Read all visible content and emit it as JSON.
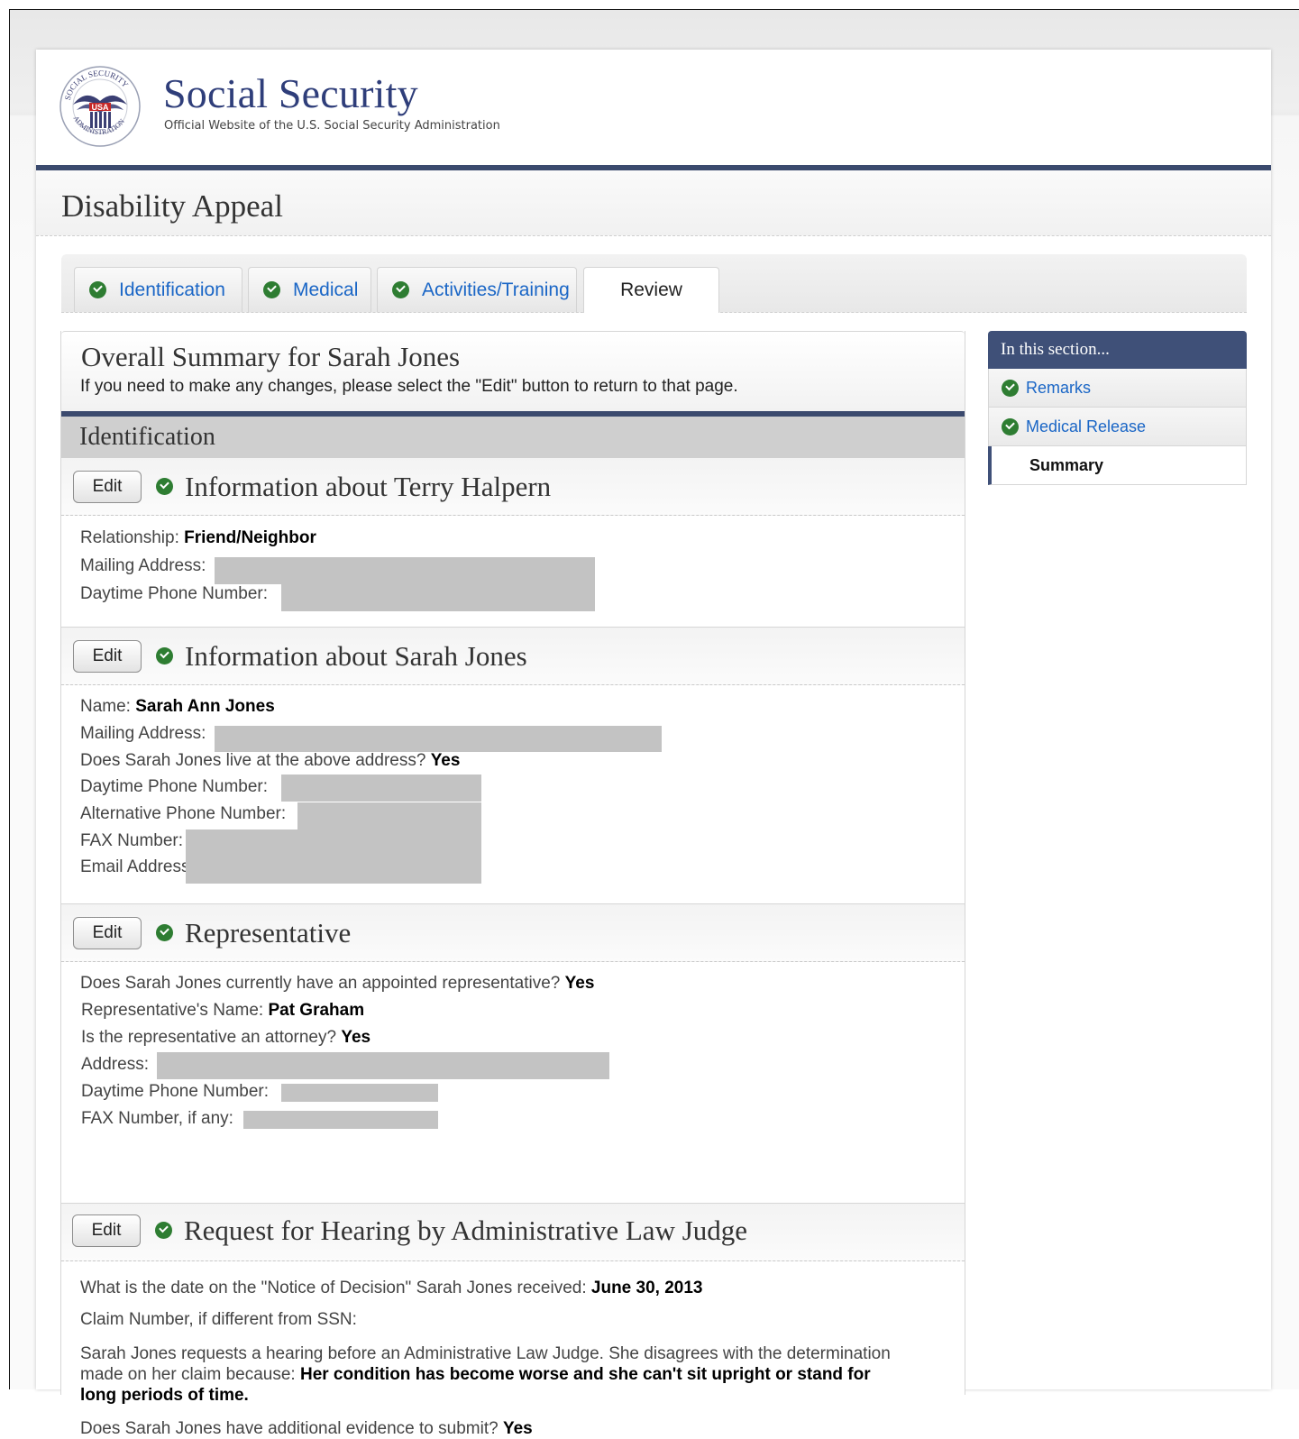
{
  "brand": {
    "title": "Social Security",
    "subtitle": "Official Website of the U.S. Social Security Administration",
    "seal_text": "SOCIAL SECURITY ADMINISTRATION",
    "seal_badge": "USA"
  },
  "app": {
    "title": "Disability Appeal"
  },
  "tabs": [
    {
      "label": "Identification",
      "complete": true
    },
    {
      "label": "Medical",
      "complete": true
    },
    {
      "label": "Activities/Training",
      "complete": true
    },
    {
      "label": "Review",
      "active": true
    }
  ],
  "summary": {
    "title": "Overall Summary for Sarah Jones",
    "note": "If you need to make any changes, please select the \"Edit\" button to return to that page.",
    "section_label": "Identification",
    "edit_label": "Edit"
  },
  "blocks": [
    {
      "title": "Information about Terry Halpern",
      "fields": [
        {
          "label": "Relationship: ",
          "value": "Friend/Neighbor"
        },
        {
          "label": "Mailing Address:",
          "value": ""
        },
        {
          "label": "Daytime Phone Number:",
          "value": ""
        }
      ]
    },
    {
      "title": "Information about Sarah Jones",
      "fields": [
        {
          "label": "Name: ",
          "value": "Sarah Ann Jones"
        },
        {
          "label": "Mailing Address:",
          "value": ""
        },
        {
          "label": "Does Sarah Jones live at the above address? ",
          "value": "Yes"
        },
        {
          "label": "Daytime Phone Number:",
          "value": ""
        },
        {
          "label": "Alternative Phone Number:",
          "value": ""
        },
        {
          "label": "FAX Number:",
          "value": ""
        },
        {
          "label": "Email Address:",
          "value": ""
        }
      ]
    },
    {
      "title": "Representative",
      "fields": [
        {
          "label": "Does Sarah Jones currently have an appointed representative? ",
          "value": "Yes"
        },
        {
          "label": "Representative's Name: ",
          "value": "Pat Graham"
        },
        {
          "label": "Is the representative an attorney? ",
          "value": "Yes"
        },
        {
          "label": "Address:",
          "value": ""
        },
        {
          "label": "Daytime Phone Number:",
          "value": ""
        },
        {
          "label": "FAX Number, if any:",
          "value": ""
        }
      ]
    },
    {
      "title": "Request for Hearing by Administrative Law Judge",
      "fields": [
        {
          "label": "What is the date on the \"Notice of Decision\" Sarah Jones received: ",
          "value": "June 30, 2013"
        },
        {
          "label": "Claim Number, if different from SSN:",
          "value": ""
        },
        {
          "label": "Sarah Jones requests a hearing before an Administrative Law Judge. She disagrees with the determination made on her claim because: ",
          "value": "Her condition has become worse and she can't sit upright or stand for long periods of time."
        },
        {
          "label": "Does Sarah Jones have additional evidence to submit? ",
          "value": "Yes"
        }
      ]
    }
  ],
  "sidebar": {
    "heading": "In this section...",
    "items": [
      {
        "label": "Remarks",
        "complete": true
      },
      {
        "label": "Medical Release",
        "complete": true
      },
      {
        "label": "Summary",
        "current": true
      }
    ]
  },
  "colors": {
    "brand_navy": "#2f3e7a",
    "rule_navy": "#3b4a6e",
    "link_blue": "#1a66c6",
    "check_green": "#2e7d32",
    "redaction_gray": "#c3c3c3"
  }
}
